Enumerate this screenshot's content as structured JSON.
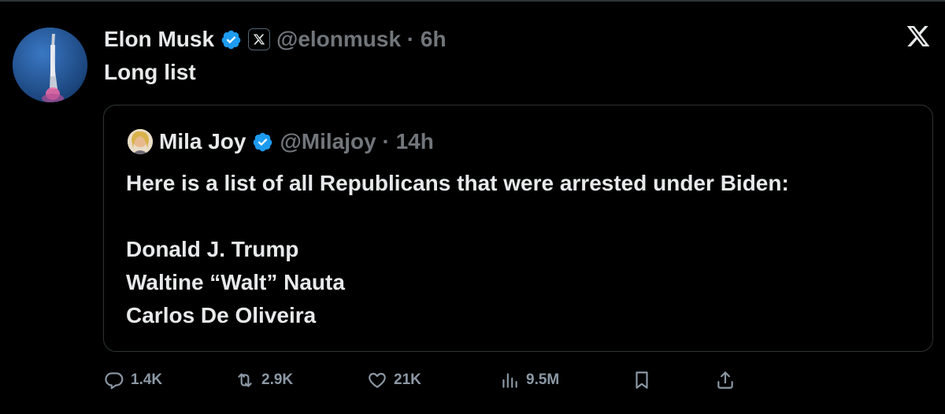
{
  "tweet": {
    "author_name": "Elon Musk",
    "handle_time": "@elonmusk · 6h",
    "text": "Long list"
  },
  "quote": {
    "author_name": "Mila Joy",
    "handle_time": "@Milajoy · 14h",
    "lines": [
      "Here is a list of all Republicans that were arrested under Biden:",
      "",
      "Donald J. Trump",
      "Waltine “Walt” Nauta",
      "Carlos De Oliveira"
    ]
  },
  "actions": {
    "replies": "1.4K",
    "reposts": "2.9K",
    "likes": "21K",
    "views": "9.5M"
  },
  "colors": {
    "background": "#000000",
    "text": "#e7e9ea",
    "secondary": "#71767b",
    "verified": "#1d9bf0",
    "border": "#2f3336"
  },
  "icons": {
    "verified": "verified-badge-icon",
    "affiliate": "x-logo-icon",
    "close": "x-logo-icon",
    "reply": "reply-icon",
    "repost": "repost-icon",
    "like": "heart-icon",
    "views": "views-icon",
    "bookmark": "bookmark-icon",
    "share": "share-icon"
  }
}
